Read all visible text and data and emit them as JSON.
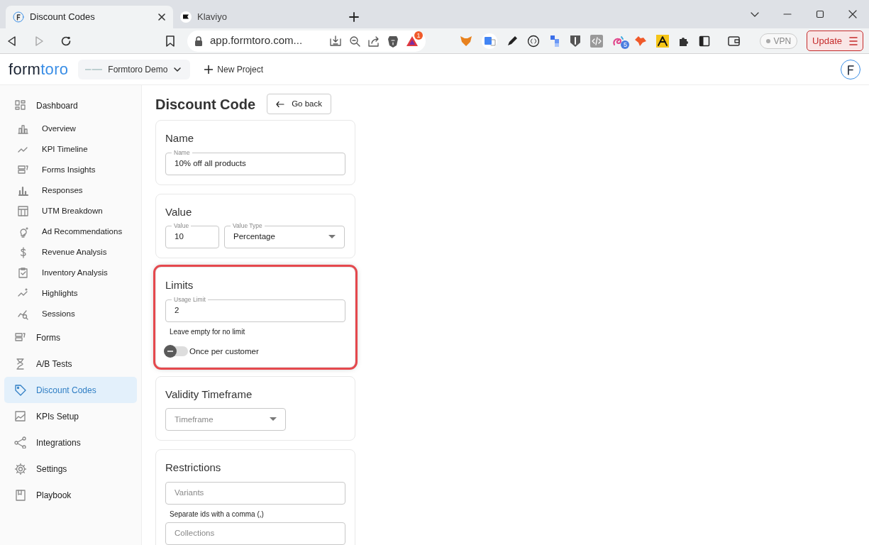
{
  "browser": {
    "tabs": [
      {
        "title": "Discount Codes",
        "selected": true
      },
      {
        "title": "Klaviyo",
        "selected": false
      }
    ],
    "url": "app.formtoro.com...",
    "rewards_badge": "1",
    "extension_badge": "5",
    "vpn": "VPN",
    "update": "Update"
  },
  "header": {
    "logo": [
      "form",
      "toro"
    ],
    "project": "Formtoro Demo",
    "new_project": "New Project"
  },
  "sidebar": {
    "items": [
      {
        "label": "Dashboard",
        "selected": false,
        "children": [
          {
            "label": "Overview",
            "selected": false
          },
          {
            "label": "KPI Timeline",
            "selected": false
          },
          {
            "label": "Forms Insights",
            "selected": false
          },
          {
            "label": "Responses",
            "selected": false
          },
          {
            "label": "UTM Breakdown",
            "selected": false
          },
          {
            "label": "Ad Recommendations",
            "selected": false
          },
          {
            "label": "Revenue Analysis",
            "selected": false
          },
          {
            "label": "Inventory Analysis",
            "selected": false
          },
          {
            "label": "Highlights",
            "selected": false
          },
          {
            "label": "Sessions",
            "selected": false
          }
        ]
      },
      {
        "label": "Forms",
        "selected": false
      },
      {
        "label": "A/B Tests",
        "selected": false
      },
      {
        "label": "Discount Codes",
        "selected": true
      },
      {
        "label": "KPIs Setup",
        "selected": false
      },
      {
        "label": "Integrations",
        "selected": false
      },
      {
        "label": "Settings",
        "selected": false
      },
      {
        "label": "Playbook",
        "selected": false
      }
    ]
  },
  "page": {
    "title": "Discount Code",
    "back_button": "Go back",
    "sections": [
      {
        "title": "Name",
        "highlighted": false,
        "fields": [
          {
            "kind": "text",
            "label": "Name",
            "value": "10% off all products"
          }
        ]
      },
      {
        "title": "Value",
        "highlighted": false,
        "fields": [
          {
            "kind": "text",
            "label": "Value",
            "value": "10"
          },
          {
            "kind": "select",
            "label": "Value Type",
            "value": "Percentage"
          }
        ]
      },
      {
        "title": "Limits",
        "highlighted": true,
        "fields": [
          {
            "kind": "text",
            "label": "Usage Limit",
            "value": "2"
          },
          {
            "kind": "help",
            "text": "Leave empty for no limit"
          },
          {
            "kind": "toggle",
            "label": "Once per customer",
            "on": false
          }
        ]
      },
      {
        "title": "Validity Timeframe",
        "highlighted": false,
        "fields": [
          {
            "kind": "select",
            "placeholder": "Timeframe"
          }
        ]
      },
      {
        "title": "Restrictions",
        "highlighted": false,
        "fields": [
          {
            "kind": "text",
            "placeholder": "Variants"
          },
          {
            "kind": "help",
            "text": "Separate ids with a comma (,)"
          },
          {
            "kind": "text",
            "placeholder": "Collections"
          }
        ]
      }
    ]
  }
}
